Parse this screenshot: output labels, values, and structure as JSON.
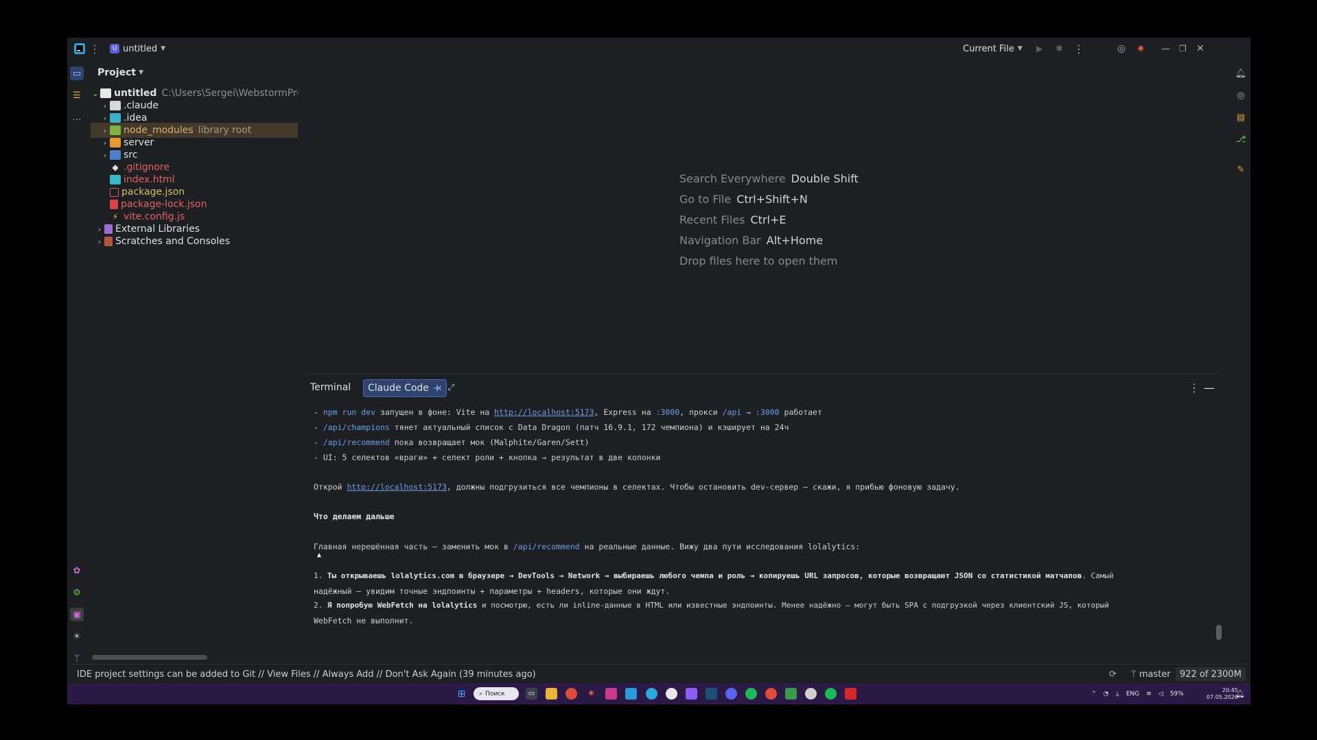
{
  "titlebar": {
    "project_badge": "U",
    "project_name": "untitled",
    "run_config": "Current File"
  },
  "project_panel": {
    "title": "Project",
    "tree": [
      {
        "name": "untitled",
        "hint": "C:\\Users\\Sergei\\WebstormProje",
        "indent": 0,
        "expanded": true,
        "icon": "folder-icon"
      },
      {
        "name": ".claude",
        "hint": "",
        "indent": 1,
        "icon": "folder-icon"
      },
      {
        "name": ".idea",
        "hint": "",
        "indent": 1,
        "icon": "idea-folder-icon"
      },
      {
        "name": "node_modules",
        "hint": "library root",
        "indent": 1,
        "icon": "node-folder-icon",
        "selected": true
      },
      {
        "name": "server",
        "hint": "",
        "indent": 1,
        "icon": "folder-icon"
      },
      {
        "name": "src",
        "hint": "",
        "indent": 1,
        "icon": "src-folder-icon"
      },
      {
        "name": ".gitignore",
        "hint": "",
        "indent": 1,
        "icon": "git-icon",
        "file": true
      },
      {
        "name": "index.html",
        "hint": "",
        "indent": 1,
        "icon": "html-icon",
        "file": true
      },
      {
        "name": "package.json",
        "hint": "",
        "indent": 1,
        "icon": "json-icon",
        "file": true
      },
      {
        "name": "package-lock.json",
        "hint": "",
        "indent": 1,
        "icon": "lock-icon",
        "file": true
      },
      {
        "name": "vite.config.js",
        "hint": "",
        "indent": 1,
        "icon": "vite-icon",
        "file": true
      },
      {
        "name": "External Libraries",
        "hint": "",
        "indent": 0,
        "icon": "library-icon"
      },
      {
        "name": "Scratches and Consoles",
        "hint": "",
        "indent": 0,
        "icon": "scratches-icon"
      }
    ]
  },
  "editor": {
    "tips": [
      {
        "label": "Search Everywhere",
        "shortcut": "Double Shift"
      },
      {
        "label": "Go to File",
        "shortcut": "Ctrl+Shift+N"
      },
      {
        "label": "Recent Files",
        "shortcut": "Ctrl+E"
      },
      {
        "label": "Navigation Bar",
        "shortcut": "Alt+Home"
      },
      {
        "label": "Drop files here to open them",
        "shortcut": ""
      }
    ]
  },
  "terminal": {
    "title": "Terminal",
    "tab": "Claude Code",
    "lines": {
      "l1": {
        "a": "- ",
        "b": "npm run dev",
        "c": " запущен в фоне: Vite на ",
        "d": "http://localhost:5173",
        "e": ", Express на ",
        "f": ":3000",
        "g": ", прокси ",
        "h": "/api",
        "i": " → ",
        "j": ":3000",
        "k": " работает"
      },
      "l2": {
        "a": "- ",
        "b": "/api/champions",
        "c": " тянет актуальный список с Data Dragon (патч 16.9.1, 172 чемпиона) и кэширует на 24ч"
      },
      "l3": {
        "a": "- ",
        "b": "/api/recommend",
        "c": " пока возвращает мок (Malphite/Garen/Sett)"
      },
      "l4": {
        "a": "- UI: 5 селектов «враги» + селект роли + кнопка → результат в две колонки"
      },
      "l5": {
        "a": "Открой ",
        "b": "http://localhost:5173",
        "c": ", должны подгрузиться все чемпионы в селектах. Чтобы остановить dev-сервер — скажи, я прибью фоновую задачу."
      },
      "l6": {
        "a": "Что делаем дальше"
      },
      "l7": {
        "a": "Главная нерешённая часть — заменить мок в ",
        "b": "/api/recommend",
        "c": " на реальные данные. Вижу два пути исследования lolalytics:"
      },
      "l8": {
        "a": "1. ",
        "b": "Ты открываешь lolalytics.com в браузере → DevTools → Network → выбираешь любого чемпа и роль → копируешь URL запросов, которые возвращают JSON со статистикой матчапов",
        "c": ". Самый"
      },
      "l9": {
        "a": "надёжный — увидим точные эндпоинты + параметры + headers, которые они ждут."
      },
      "l10": {
        "a": "2. ",
        "b": "Я попробую WebFetch на lolalytics",
        "c": " и посмотрю, есть ли inline-данные в HTML или известные эндпоинты. Менее надёжно — могут быть SPA с подгрузкой через клиентский JS, который"
      },
      "l11": {
        "a": "WebFetch не выполнит."
      }
    }
  },
  "statusbar": {
    "message": "IDE project settings can be added to Git // View Files // Always Add // Don't Ask Again (39 minutes ago)",
    "branch": "master",
    "memory": "922 of 2300M"
  },
  "taskbar": {
    "search": "Поиск",
    "lang": "ENG",
    "battery": "59%",
    "time": "20:45",
    "date": "07.05.2026"
  },
  "colors": {
    "accent": "#3574f0",
    "selected_row": "#43392a",
    "link": "#6b9ee8",
    "taskbar": "#2b1a45"
  }
}
